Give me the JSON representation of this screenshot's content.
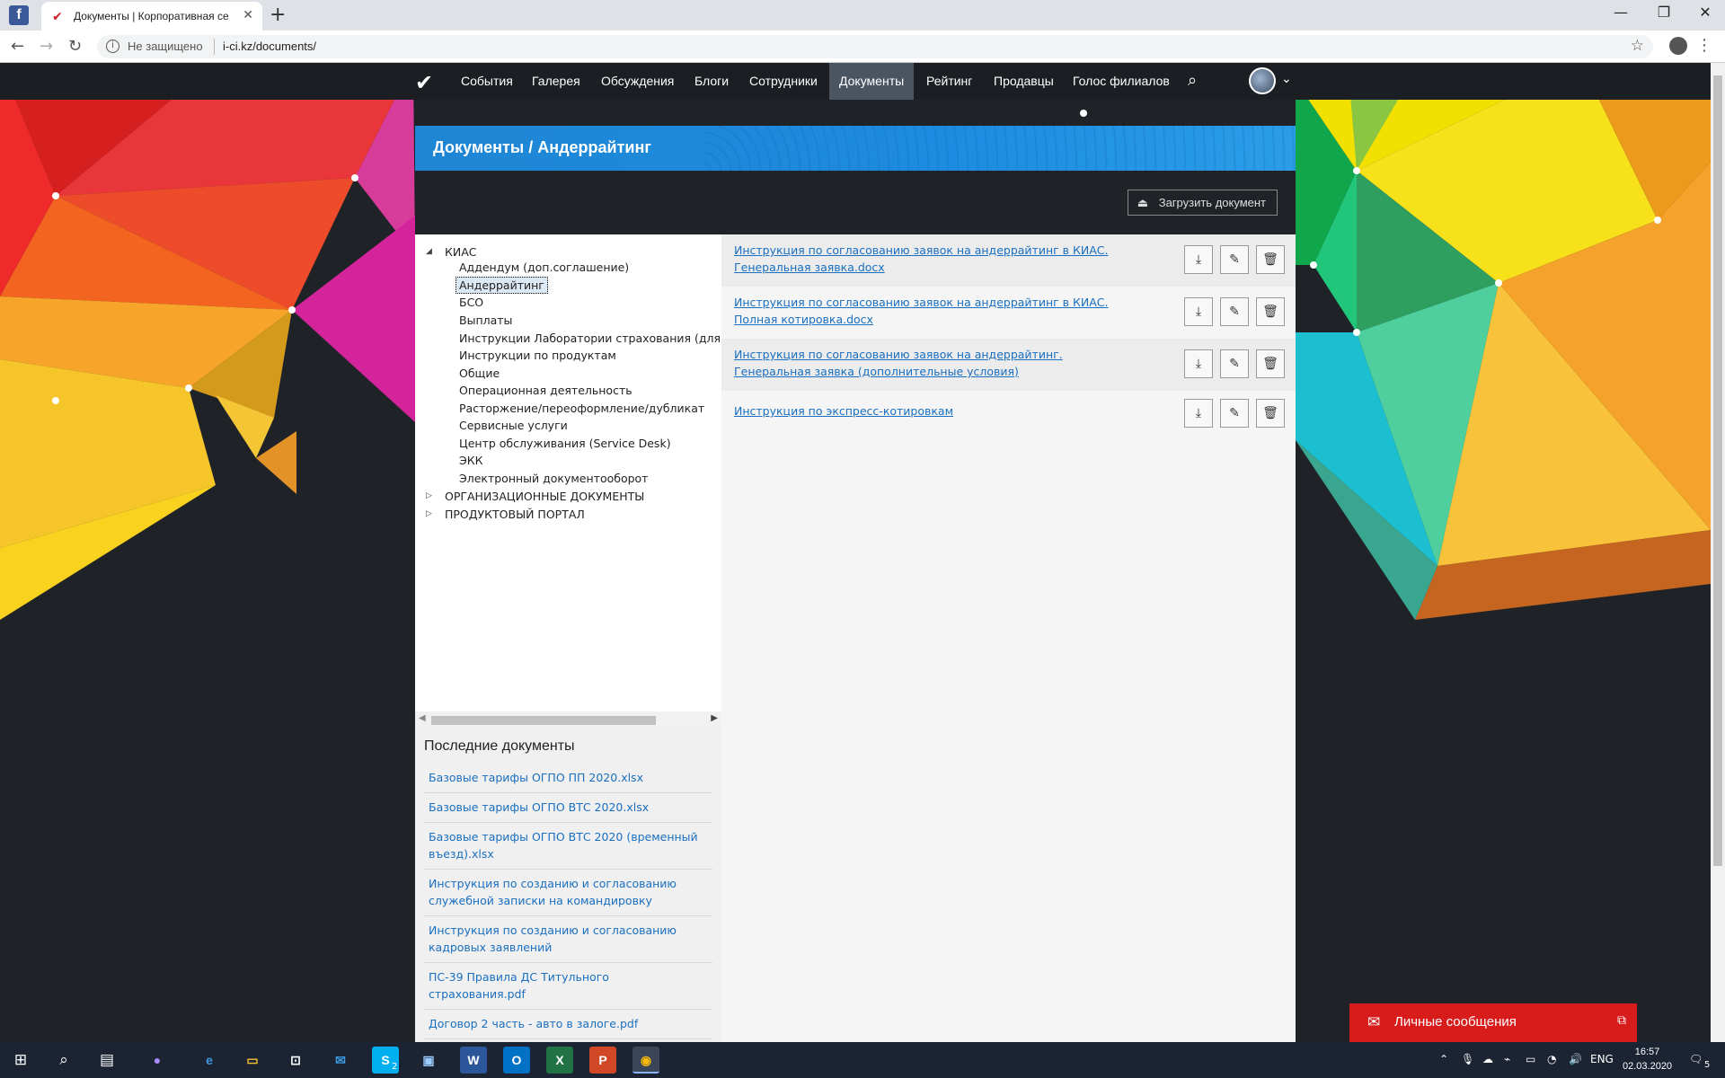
{
  "browser": {
    "tab_title": "Документы | Корпоративная се",
    "security_label": "Не защищено",
    "url": "i-ci.kz/documents/"
  },
  "nav": {
    "items": [
      "События",
      "Галерея",
      "Обсуждения",
      "Блоги",
      "Сотрудники",
      "Документы",
      "Рейтинг",
      "Продавцы",
      "Голос филиалов"
    ],
    "active": "Документы"
  },
  "panel": {
    "title": "Документы / Андеррайтинг",
    "upload_label": "Загрузить документ"
  },
  "tree": {
    "root": "КИАС",
    "children": [
      "Аддендум (доп.соглашение)",
      "Андеррайтинг",
      "БСО",
      "Выплаты",
      "Инструкции Лаборатории страхования (для инс",
      "Инструкции по продуктам",
      "Общие",
      "Операционная деятельность",
      "Расторжение/переоформление/дубликат",
      "Сервисные услуги",
      "Центр обслуживания (Service Desk)",
      "ЭКК",
      "Электронный документооборот"
    ],
    "selected": "Андеррайтинг",
    "other_roots": [
      "ОРГАНИЗАЦИОННЫЕ ДОКУМЕНТЫ",
      "ПРОДУКТОВЫЙ ПОРТАЛ"
    ]
  },
  "documents": [
    "Инструкция по согласованию заявок на андеррайтинг в КИАС. Генеральная заявка.docx",
    "Инструкция по согласованию заявок на андеррайтинг в КИАС. Полная котировка.docx",
    "Инструкция по согласованию заявок на андеррайтинг. Генеральная заявка (дополнительные условия)",
    "Инструкция по экспресс-котировкам"
  ],
  "recent": {
    "heading": "Последние документы",
    "items": [
      "Базовые тарифы ОГПО ПП 2020.xlsx",
      "Базовые тарифы ОГПО ВТС 2020.xlsx",
      "Базовые тарифы ОГПО ВТС 2020 (временный въезд).xlsx",
      "Инструкция по созданию и согласованию служебной записки на командировку",
      "Инструкция по созданию и согласованию кадровых заявлений",
      "ПС-39 Правила ДС Титульного страхования.pdf",
      "Договор 2 часть - авто в залоге.pdf"
    ]
  },
  "messages": {
    "label": "Личные сообщения"
  },
  "taskbar": {
    "lang": "ENG",
    "time": "16:57",
    "date": "02.03.2020",
    "skype_badge": "2",
    "notif_count": "5"
  },
  "colors": {
    "accent_blue": "#1f86d4",
    "link": "#1a6fc0",
    "messages_red": "#d81b1b",
    "nav_bg": "#1b1e22"
  }
}
